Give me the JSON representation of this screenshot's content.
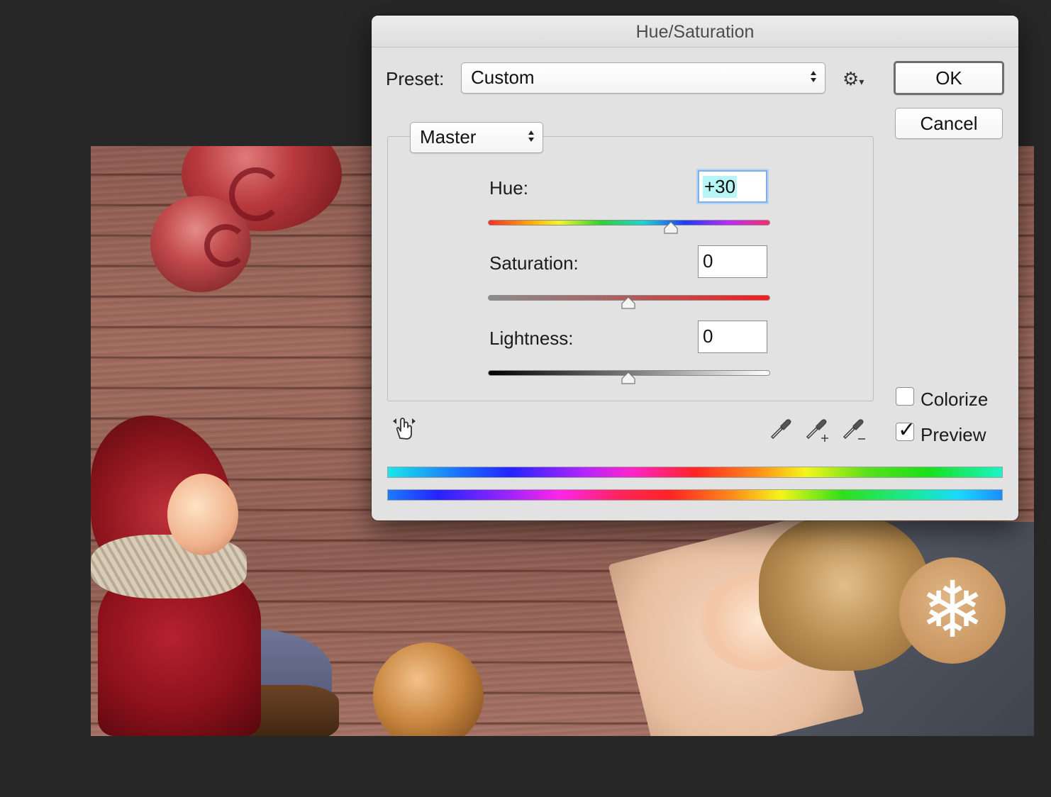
{
  "dialog": {
    "title": "Hue/Saturation",
    "preset_label": "Preset:",
    "preset_value": "Custom",
    "ok_label": "OK",
    "cancel_label": "Cancel",
    "channel_value": "Master",
    "hue": {
      "label": "Hue:",
      "value": "+30",
      "level": 30,
      "range": [
        -180,
        180
      ]
    },
    "saturation": {
      "label": "Saturation:",
      "value": "0",
      "level": 0,
      "range": [
        -100,
        100
      ]
    },
    "lightness": {
      "label": "Lightness:",
      "value": "0",
      "level": 0,
      "range": [
        -100,
        100
      ]
    },
    "colorize": {
      "label": "Colorize",
      "checked": false
    },
    "preview": {
      "label": "Preview",
      "checked": true
    },
    "icons": [
      "gear-menu-icon",
      "targeted-adjustment-hand-icon",
      "eyedropper-icon",
      "eyedropper-add-icon",
      "eyedropper-subtract-icon"
    ]
  },
  "colors": {
    "dialog_bg": "#e2e2e2",
    "app_bg": "#272727",
    "focus_highlight": "#b8f6f6"
  }
}
